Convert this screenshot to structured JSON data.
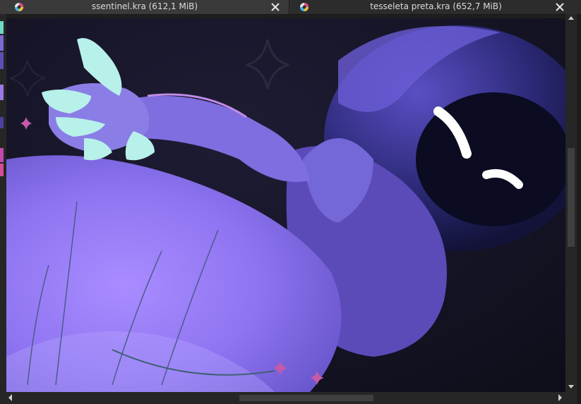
{
  "tabs": [
    {
      "title": "ssentinel.kra (612,1 MiB)",
      "icon": "krita-icon",
      "close_icon": "close-icon"
    },
    {
      "title": "tesseleta preta.kra (652,7 MiB)",
      "icon": "krita-icon",
      "close_icon": "close-icon"
    }
  ],
  "canvas": {
    "description_icon": "artwork"
  },
  "colors": {
    "background": "#141424",
    "accent_purple": "#8a6cf0",
    "tab_active": "#3a3a3a"
  }
}
